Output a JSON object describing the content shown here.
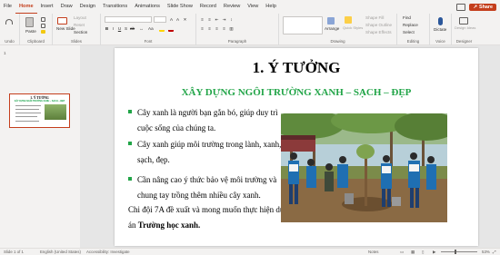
{
  "tabs": [
    "File",
    "Home",
    "Insert",
    "Draw",
    "Design",
    "Transitions",
    "Animations",
    "Slide Show",
    "Record",
    "Review",
    "View",
    "Help"
  ],
  "active_tab": "Home",
  "share_label": "Share",
  "ribbon": {
    "groups": [
      "Undo",
      "Clipboard",
      "Slides",
      "Font",
      "Paragraph",
      "Drawing",
      "Editing",
      "Voice",
      "Designer"
    ],
    "paste": "Paste",
    "new_slide": "New Slide",
    "layout": "Layout",
    "reset": "Reset",
    "section": "Section",
    "arrange": "Arrange",
    "quick_styles": "Quick Styles",
    "shape_fill": "Shape Fill",
    "shape_outline": "Shape Outline",
    "shape_effects": "Shape Effects",
    "find": "Find",
    "replace": "Replace",
    "select": "Select",
    "dictate": "Dictate",
    "design_ideas": "Design Ideas"
  },
  "thumbnail": {
    "number": "1",
    "title": "1. Ý TƯỞNG",
    "subtitle": "XÂY DỰNG NGÔI TRƯỜNG XANH – SẠCH – ĐẸP"
  },
  "slide": {
    "title": "1. Ý TƯỞNG",
    "subtitle": "XÂY DỰNG NGÔI TRƯỜNG XANH – SẠCH – ĐẸP",
    "bullets": [
      "Cây xanh là người bạn gắn bó, giúp duy trì cuộc sống của chúng ta.",
      "Cây xanh giúp môi trường trong lành, xanh, sạch, đẹp.",
      "Cần nâng cao ý thức bảo vệ môi trường và chung tay trồng thêm nhiều cây xanh."
    ],
    "closing_text": "Chi đội 7A đề xuất và mong muốn thực hiện dự án ",
    "closing_bold": "Trường học xanh."
  },
  "status": {
    "slide_info": "Slide 1 of 1",
    "language": "English (United States)",
    "accessibility": "Accessibility: Investigate",
    "notes": "Notes",
    "zoom": "53%"
  },
  "colors": {
    "accent": "#c43e1c",
    "green_heading": "#22a548",
    "bullet": "#22a548"
  }
}
